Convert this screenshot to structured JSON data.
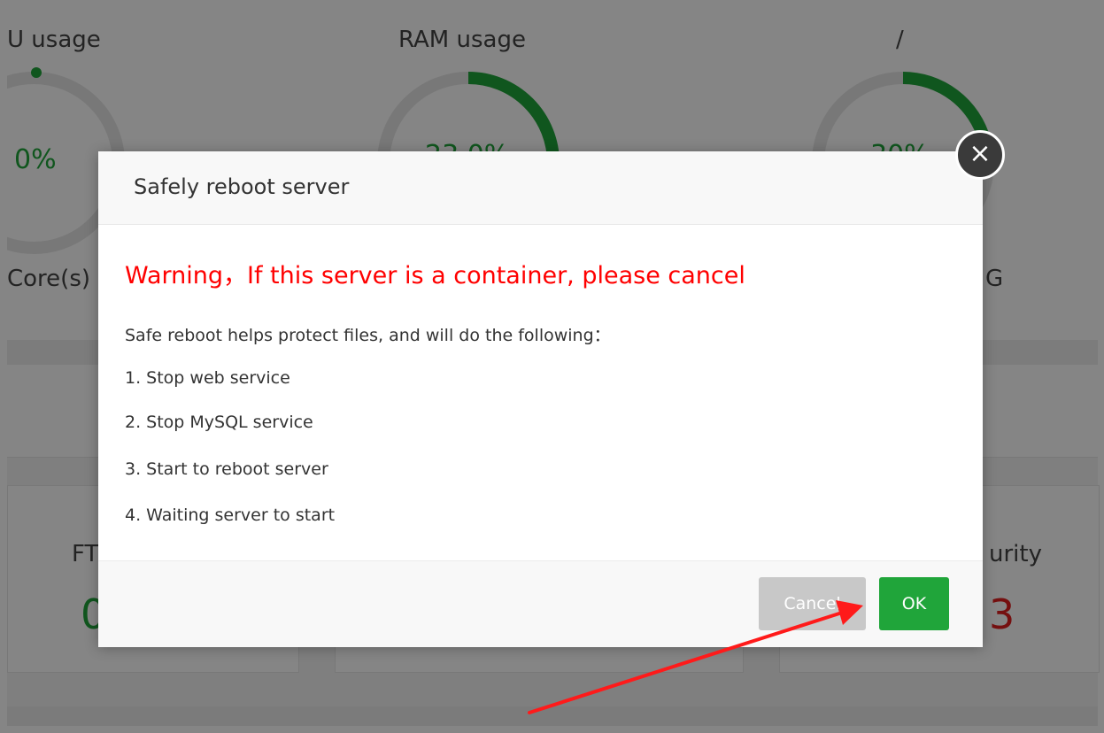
{
  "background": {
    "gauges": [
      {
        "label": "U usage",
        "value": "0%",
        "sub": "Core(s)"
      },
      {
        "label": "RAM usage",
        "value": "23.0%"
      },
      {
        "label": "/",
        "value": "30%",
        "sub": "G"
      }
    ],
    "cards": [
      {
        "title": "FT",
        "value": "0",
        "value_color": "#20a53a"
      },
      {
        "title": "urity",
        "value": "3",
        "value_color": "#e02020"
      }
    ]
  },
  "dialog": {
    "title": "Safely reboot server",
    "warning": "Warning，If this server is a container, please cancel",
    "intro": "Safe reboot helps protect files, and will do the following：",
    "steps": [
      "1. Stop web service",
      "2. Stop MySQL service",
      "3. Start to reboot server",
      "4. Waiting server to start"
    ],
    "cancel_label": "Cancel",
    "ok_label": "OK",
    "close_glyph": "×"
  },
  "colors": {
    "accent": "#20a53a",
    "warning": "#ff0000",
    "annotation_arrow": "#ff1a1a"
  }
}
